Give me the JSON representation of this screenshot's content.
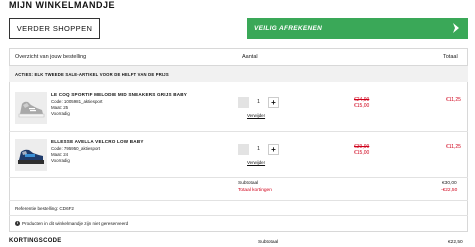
{
  "page": {
    "title": "MIJN WINKELMANDJE"
  },
  "actions": {
    "continue_label": "VERDER SHOPPEN",
    "checkout_label": "VEILIG AFREKENEN"
  },
  "table": {
    "headers": {
      "overview": "Overzicht van jouw bestelling",
      "quantity": "Aantal",
      "total": "Totaal"
    },
    "promo": "ACTIES: ELK TWEEDE SALE-ARTIKEL VOOR DE HELFT VAN DE PRIJS"
  },
  "items": [
    {
      "name": "LE COQ SPORTIF MELODIE MID SNEAKERS GRIJS BABY",
      "code": "Code: 1005981_aktiesport",
      "size": "Maat: 25",
      "stock": "Voorradig",
      "quantity": "1",
      "remove_label": "Verwijder",
      "old_price": "€24,99",
      "new_price": "€15,00",
      "line_total": "€11,25"
    },
    {
      "name": "ELLESSE AVELLA VELCRO LOW BABY",
      "code": "Code: 795950_aktiesport",
      "size": "Maat: 24",
      "stock": "Voorradig",
      "quantity": "1",
      "remove_label": "Verwijder",
      "old_price": "€39,99",
      "new_price": "€15,00",
      "line_total": "€11,25"
    }
  ],
  "summary": {
    "subtotal_label": "Subtotaal",
    "subtotal_value": "€30,00",
    "discount_label": "Totaal kortingen",
    "discount_value": "-€22,50"
  },
  "footer": {
    "reference": "Referentie bestelling: CD6F2",
    "delivery_note": "Producten in dit winkelmandje zijn niet gereserveerd",
    "coupon_title": "KORTINGSCODE",
    "subtotal_label": "Subtotaal",
    "subtotal_value": "€22,50"
  },
  "colors": {
    "checkout": "#3aa858",
    "price_red": "#d0021b"
  }
}
